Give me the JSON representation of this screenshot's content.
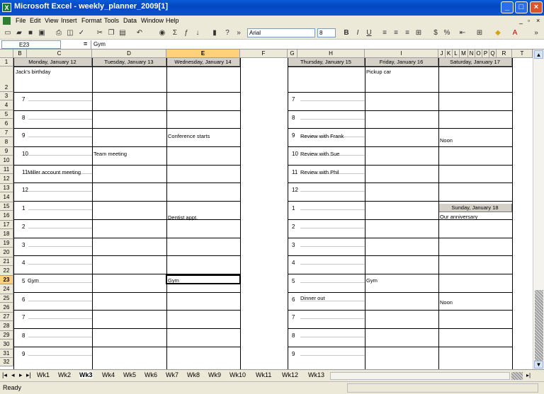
{
  "window": {
    "title": "Microsoft Excel - weekly_planner_2009[1]"
  },
  "menu": [
    "File",
    "Edit",
    "View",
    "Insert",
    "Format",
    "Tools",
    "Data",
    "Window",
    "Help"
  ],
  "toolbar": {
    "font": "Arial",
    "size": "8"
  },
  "formula": {
    "cell_ref": "E23",
    "fx": "=",
    "value": "Gym"
  },
  "columns": [
    "B",
    "C",
    "D",
    "E",
    "F",
    "G",
    "H",
    "I",
    "J",
    "K",
    "L",
    "M",
    "N",
    "O",
    "P",
    "Q",
    "R",
    "T"
  ],
  "rows": [
    "1",
    "2",
    "3",
    "4",
    "5",
    "6",
    "7",
    "8",
    "9",
    "10",
    "11",
    "12",
    "13",
    "14",
    "15",
    "16",
    "17",
    "18",
    "19",
    "20",
    "21",
    "22",
    "23",
    "24",
    "25",
    "26",
    "27",
    "28",
    "29",
    "30",
    "31",
    "32"
  ],
  "days": {
    "monday": "Monday, January 12",
    "tuesday": "Tuesday, January 13",
    "wednesday": "Wednesday, January 14",
    "thursday": "Thursday, January 15",
    "friday": "Friday, January 16",
    "saturday": "Saturday, January 17",
    "sunday": "Sunday, January 18"
  },
  "hours": [
    "7",
    "8",
    "9",
    "10",
    "11",
    "12",
    "1",
    "2",
    "3",
    "4",
    "5",
    "6",
    "7",
    "8",
    "9"
  ],
  "hours_right": [
    "7",
    "8",
    "9",
    "10",
    "11",
    "12",
    "1",
    "2",
    "3",
    "4",
    "5",
    "6",
    "7",
    "8",
    "9"
  ],
  "entries": {
    "jacks_birthday": "Jack's birthday",
    "pickup_car": "Pickup car",
    "conference": "Conference starts",
    "review_frank": "Review with Frank",
    "noon_sat": "Noon",
    "team_meeting": "Team meeting",
    "review_sue": "Review with Sue",
    "miller": "Miller account meeting",
    "review_phil": "Review with Phil",
    "dentist": "Dentist appt.",
    "our_anniversary": "Our anniversary",
    "gym_mon": "Gym",
    "gym_wed": "Gym",
    "gym_fri": "Gym",
    "dinner_out": "Dinner out",
    "noon_sun": "Noon"
  },
  "tabs": [
    "Wk1",
    "Wk2",
    "Wk3",
    "Wk4",
    "Wk5",
    "Wk6",
    "Wk7",
    "Wk8",
    "Wk9",
    "Wk10",
    "Wk11",
    "Wk12",
    "Wk13"
  ],
  "active_tab": "Wk3",
  "status": "Ready"
}
